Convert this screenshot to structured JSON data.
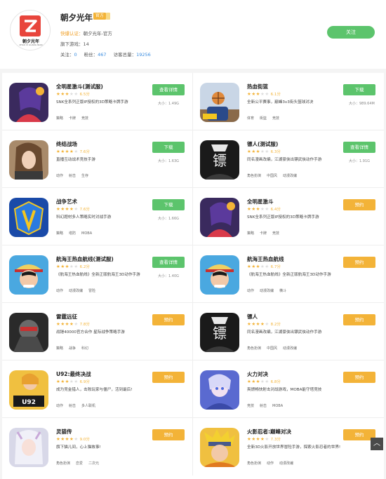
{
  "developer": {
    "name": "朝夕光年",
    "badge": "官方",
    "logo_text": "朝夕光年",
    "logo_sub": "ZHAO XI GUANG NIAN",
    "verify_label": "快爆认证：",
    "verify_value": "朝夕光年-官方",
    "games_label": "旗下游戏：",
    "games_count": "14",
    "follow_label": "关注：",
    "follow_count": "0",
    "fans_label": "粉丝：",
    "fans_count": "467",
    "visits_label": "访客总量：",
    "visits_count": "19256",
    "follow_button": "关注"
  },
  "colors": {
    "green": "#5cc46c",
    "orange": "#f3b338",
    "blue": "#3a8de0"
  },
  "games": [
    {
      "title": "全明星激斗(测试服)",
      "stars": 3,
      "score": "6.5分",
      "desc": "SNK全系列正版IP授权的3D策略卡牌手游",
      "tags": [
        "策略",
        "卡牌",
        "竞技"
      ],
      "button": "查看详情",
      "btn_color": "green",
      "size": "大小：1.49G",
      "icon": "fighter-girl"
    },
    {
      "title": "热血街篮",
      "stars": 3,
      "score": "6.1分",
      "desc": "全新公平赛事，巅峰3v3街头篮球对决",
      "tags": [
        "体育",
        "街篮",
        "竞技"
      ],
      "button": "下载",
      "btn_color": "green",
      "size": "大小：989.64M",
      "icon": "basketball"
    },
    {
      "title": "终结战场",
      "stars": 4,
      "score": "7.6分",
      "desc": "直播互动战术竞技手游",
      "tags": [
        "动作",
        "射击",
        "生存"
      ],
      "button": "下载",
      "btn_color": "green",
      "size": "大小：1.63G",
      "icon": "soldier-girl"
    },
    {
      "title": "镖人(测试服)",
      "stars": 3,
      "score": "6.3分",
      "desc": "同名漫画改编，江湖豪侠出镖武侠动作手游",
      "tags": [
        "角色扮演",
        "中国风",
        "动漫改编"
      ],
      "button": "查看详情",
      "btn_color": "green",
      "size": "大小：1.91G",
      "icon": "biao-ren"
    },
    {
      "title": "战争艺术",
      "stars": 4,
      "score": "7.6分",
      "desc": "科幻题材多人策略实时对战手游",
      "tags": [
        "策略",
        "塔防",
        "MOBA"
      ],
      "button": "下载",
      "btn_color": "green",
      "size": "大小：1.66G",
      "icon": "war-art"
    },
    {
      "title": "全明星激斗",
      "stars": 3,
      "score": "6.4分",
      "desc": "SNK全系列正版IP授权的3D策略卡牌手游",
      "tags": [
        "策略",
        "卡牌",
        "竞技"
      ],
      "button": "预约",
      "btn_color": "orange",
      "size": "",
      "icon": "fighter-girl"
    },
    {
      "title": "航海王热血航线(测试服)",
      "stars": 3,
      "score": "6.2分",
      "desc": "《航海王热血航线》全新正版航海王3D动作手游",
      "tags": [
        "动作",
        "动漫改编",
        "冒险"
      ],
      "button": "查看详情",
      "btn_color": "green",
      "size": "大小：1.40G",
      "icon": "one-piece"
    },
    {
      "title": "航海王热血航线",
      "stars": 3,
      "score": "6.7分",
      "desc": "《航海王热血航线》全新正版航海王3D动作手游",
      "tags": [
        "动作",
        "动漫改编",
        "横斗"
      ],
      "button": "预约",
      "btn_color": "orange",
      "size": "",
      "icon": "one-piece"
    },
    {
      "title": "雷霆远征",
      "stars": 4,
      "score": "7.8分",
      "desc": "战锤40000官方合作 星际战争策略手游",
      "tags": [
        "策略",
        "战争",
        "科幻"
      ],
      "button": "预约",
      "btn_color": "orange",
      "size": "",
      "icon": "warhammer"
    },
    {
      "title": "镖人",
      "stars": 4,
      "score": "8.2分",
      "desc": "同名漫画改编，江湖豪侠出镖武侠动作手游",
      "tags": [
        "角色扮演",
        "中国风",
        "动漫改编"
      ],
      "button": "预约",
      "btn_color": "orange",
      "size": "",
      "icon": "biao-ren"
    },
    {
      "title": "U92:最终决战",
      "stars": 3,
      "score": "6.9分",
      "desc": "成为竞金猎人，击败玩家与僵尸，活到最后!",
      "tags": [
        "动作",
        "射击",
        "多人联机"
      ],
      "button": "预约",
      "btn_color": "orange",
      "size": "",
      "icon": "u92"
    },
    {
      "title": "火力对决",
      "stars": 3,
      "score": "6.8分",
      "desc": "爽燃畅快射击对战游戏，MOBA能守塔竞技",
      "tags": [
        "竞技",
        "射击",
        "MOBA"
      ],
      "button": "预约",
      "btn_color": "orange",
      "size": "",
      "icon": "firepower"
    },
    {
      "title": "灵猫传",
      "stars": 4,
      "score": "9.0分",
      "desc": "旗下猫儿间，心上猫故事!",
      "tags": [
        "角色扮演",
        "恋爱",
        "二次元"
      ],
      "button": "预约",
      "btn_color": "orange",
      "size": "",
      "icon": "ling-mao"
    },
    {
      "title": "火影忍者:巅峰对决",
      "stars": 4,
      "score": "7.3分",
      "desc": "全新3D火影开放世界冒险手游，探索火影忍者的世界!",
      "tags": [
        "角色扮演",
        "动作",
        "动漫改编"
      ],
      "button": "预约",
      "btn_color": "orange",
      "size": "",
      "icon": "naruto"
    }
  ],
  "scroll_top_label": "︿"
}
